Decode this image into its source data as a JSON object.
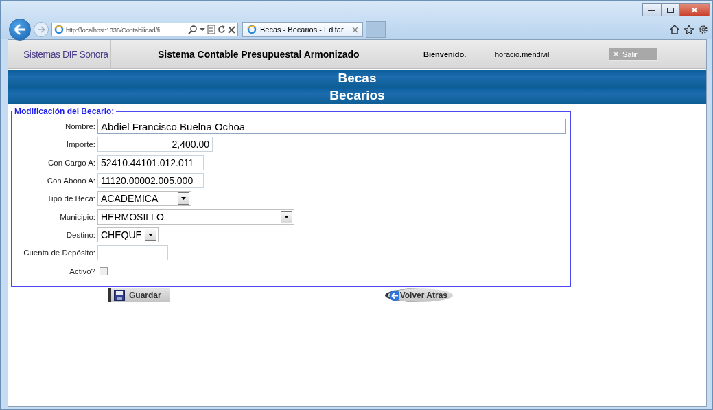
{
  "browser": {
    "address": "http://localhost:1336/Contabilidad/fi",
    "tab_title": "Becas - Becarios - Editar"
  },
  "header": {
    "logo": "Sistemas DIF Sonora",
    "title": "Sistema Contable Presupuestal Armonizado",
    "welcome": "Bienvenido.",
    "user": "horacio.mendivil",
    "logout": "Salir"
  },
  "banners": [
    "Becas",
    "Becarios"
  ],
  "form": {
    "legend": "Modificación del Becario:",
    "fields": [
      {
        "kind": "text",
        "label": "Nombre:",
        "value": "Abdiel Francisco Buelna Ochoa"
      },
      {
        "kind": "text",
        "label": "Importe:",
        "value": "2,400.00"
      },
      {
        "kind": "text",
        "label": "Con Cargo A:",
        "value": "52410.44101.012.011"
      },
      {
        "kind": "text",
        "label": "Con Abono A:",
        "value": "11120.00002.005.000"
      },
      {
        "kind": "select",
        "label": "Tipo de Beca:",
        "value": "ACADEMICA"
      },
      {
        "kind": "select",
        "label": "Municipio:",
        "value": "HERMOSILLO"
      },
      {
        "kind": "select",
        "label": "Destino:",
        "value": "CHEQUE"
      },
      {
        "kind": "text",
        "label": "Cuenta de Depósito:"
      },
      {
        "kind": "checkbox",
        "label": "Activo?",
        "checked": false
      }
    ]
  },
  "buttons": [
    {
      "label": "Guardar",
      "kind": "save"
    },
    {
      "label": "Volver Atras",
      "kind": "back"
    }
  ]
}
